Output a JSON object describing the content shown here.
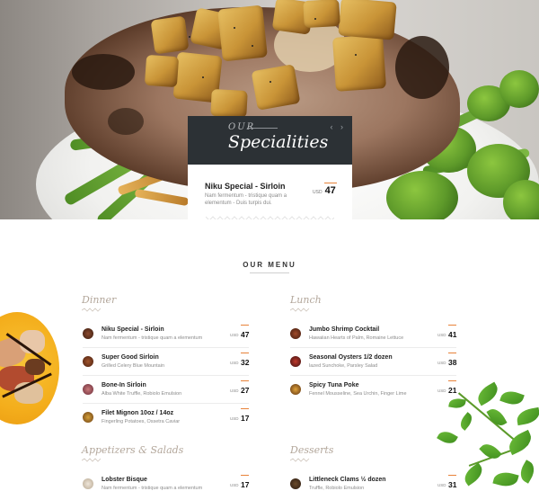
{
  "hero": {
    "specialities": {
      "eyebrow": "OUR",
      "title": "Specialities",
      "arrows": "‹ ›",
      "item": {
        "name": "Niku Special - Sirloin",
        "description": "Nam fermentum - tristique quam a elementum - Duis turpis dui.",
        "currency": "USD",
        "price": "47"
      }
    }
  },
  "menu": {
    "title": "OUR MENU",
    "sections": {
      "dinner": {
        "title": "Dinner",
        "items": [
          {
            "name": "Niku Special - Sirloin",
            "description": "Nam fermentum - tristique quam a elementum",
            "currency": "USD",
            "price": "47"
          },
          {
            "name": "Super Good Sirloin",
            "description": "Grilled Celery Blue Mountain",
            "currency": "USD",
            "price": "32"
          },
          {
            "name": "Bone-In Sirloin",
            "description": "Alba White Truffle, Robiolo Emulsion",
            "currency": "USD",
            "price": "27"
          },
          {
            "name": "Filet Mignon 10oz / 14oz",
            "description": "Fingerling Potatoes, Ossetra Caviar",
            "currency": "USD",
            "price": "17"
          }
        ]
      },
      "lunch": {
        "title": "Lunch",
        "items": [
          {
            "name": "Jumbo Shrimp Cocktail",
            "description": "Hawaiian Hearts of Palm, Romaine Lettuce",
            "currency": "USD",
            "price": "41"
          },
          {
            "name": "Seasonal Oysters 1/2 dozen",
            "description": "lazed Sunchoke, Parsley Salad",
            "currency": "USD",
            "price": "38"
          },
          {
            "name": "Spicy Tuna Poke",
            "description": "Fennel Mousseline, Sea Urchin, Finger Lime",
            "currency": "USD",
            "price": "21"
          }
        ]
      },
      "appetizers": {
        "title": "Appetizers & Salads",
        "items": [
          {
            "name": "Lobster Bisque",
            "description": "Nam fermentum - tristique quam a elementum",
            "currency": "USD",
            "price": "17"
          }
        ]
      },
      "desserts": {
        "title": "Desserts",
        "items": [
          {
            "name": "Littleneck Clams ½ dozen",
            "description": "Truffle, Robiolo Emulsion",
            "currency": "USD",
            "price": "31"
          }
        ]
      }
    }
  },
  "colors": {
    "accent": "#e8833a",
    "dark_card": "#2c3135",
    "category": "#b3a79b"
  },
  "icons": [
    "prev-arrow-icon",
    "next-arrow-icon"
  ]
}
